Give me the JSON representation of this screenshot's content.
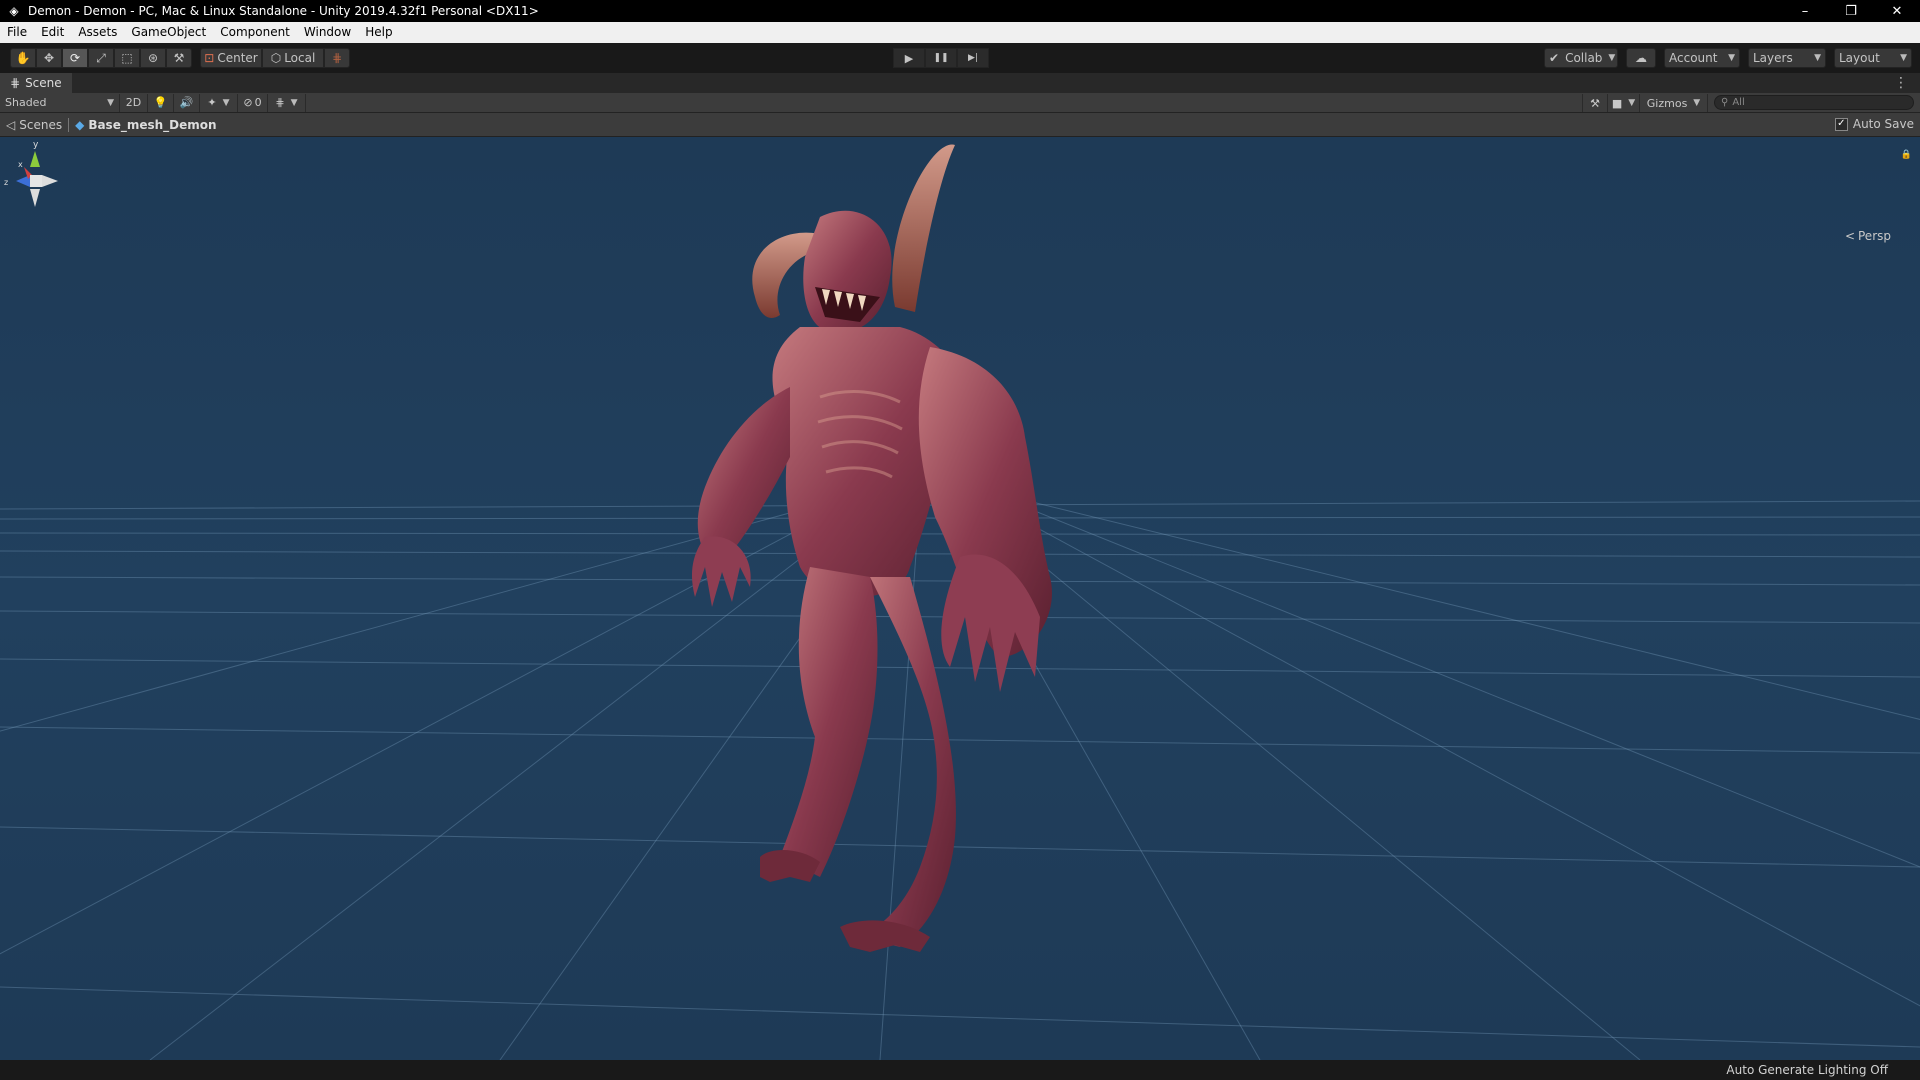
{
  "window": {
    "title": "Demon - Demon - PC, Mac & Linux Standalone - Unity 2019.4.32f1 Personal <DX11>",
    "icon": "unity-logo-icon",
    "controls": {
      "minimize": "–",
      "restore": "❐",
      "close": "✕"
    }
  },
  "menubar": {
    "items": [
      "File",
      "Edit",
      "Assets",
      "GameObject",
      "Component",
      "Window",
      "Help"
    ]
  },
  "toolbar": {
    "transform_tools": [
      {
        "icon": "hand-icon",
        "glyph": "✋",
        "active": false
      },
      {
        "icon": "move-icon",
        "glyph": "✥",
        "active": false
      },
      {
        "icon": "rotate-icon",
        "glyph": "⟳",
        "active": true
      },
      {
        "icon": "scale-icon",
        "glyph": "⤢",
        "active": false
      },
      {
        "icon": "rect-tool-icon",
        "glyph": "⬚",
        "active": false
      },
      {
        "icon": "transform-tool-icon",
        "glyph": "⊛",
        "active": false
      },
      {
        "icon": "custom-tool-icon",
        "glyph": "⚒",
        "active": false
      }
    ],
    "pivot_label": "Center",
    "space_label": "Local",
    "snap_icon": "grid-snap-icon",
    "play": "▶",
    "pause": "❚❚",
    "step": "▶|",
    "collab_label": "Collab",
    "cloud_icon": "cloud-icon",
    "account_label": "Account",
    "layers_label": "Layers",
    "layout_label": "Layout"
  },
  "scene_tab": {
    "label": "Scene",
    "icon": "scene-grid-icon",
    "menu_glyph": "⋮"
  },
  "scene_toolbar": {
    "draw_mode": "Shaded",
    "mode_2d": "2D",
    "lighting_icon": "light-bulb-icon",
    "audio_icon": "speaker-icon",
    "effects_icon": "effects-icon",
    "hidden_count": "0",
    "grid_icon": "grid-icon",
    "tools_icon": "tools-icon",
    "camera_icon": "camera-icon",
    "gizmos_label": "Gizmos",
    "search_placeholder": "All"
  },
  "breadcrumb": {
    "scenes_label": "Scenes",
    "prefab_name": "Base_mesh_Demon",
    "prefab_icon": "prefab-cube-icon",
    "autosave_label": "Auto Save",
    "autosave_checked": true
  },
  "viewport": {
    "background_color": "#21405e",
    "grid_color": "#6f93b3",
    "projection_label": "Persp",
    "gizmo_axes": {
      "y": "y",
      "x": "x",
      "z": "z"
    },
    "model": {
      "name": "demon-model",
      "skin_color": "#8a3a4e"
    }
  },
  "status": {
    "text": "Auto Generate Lighting Off"
  }
}
